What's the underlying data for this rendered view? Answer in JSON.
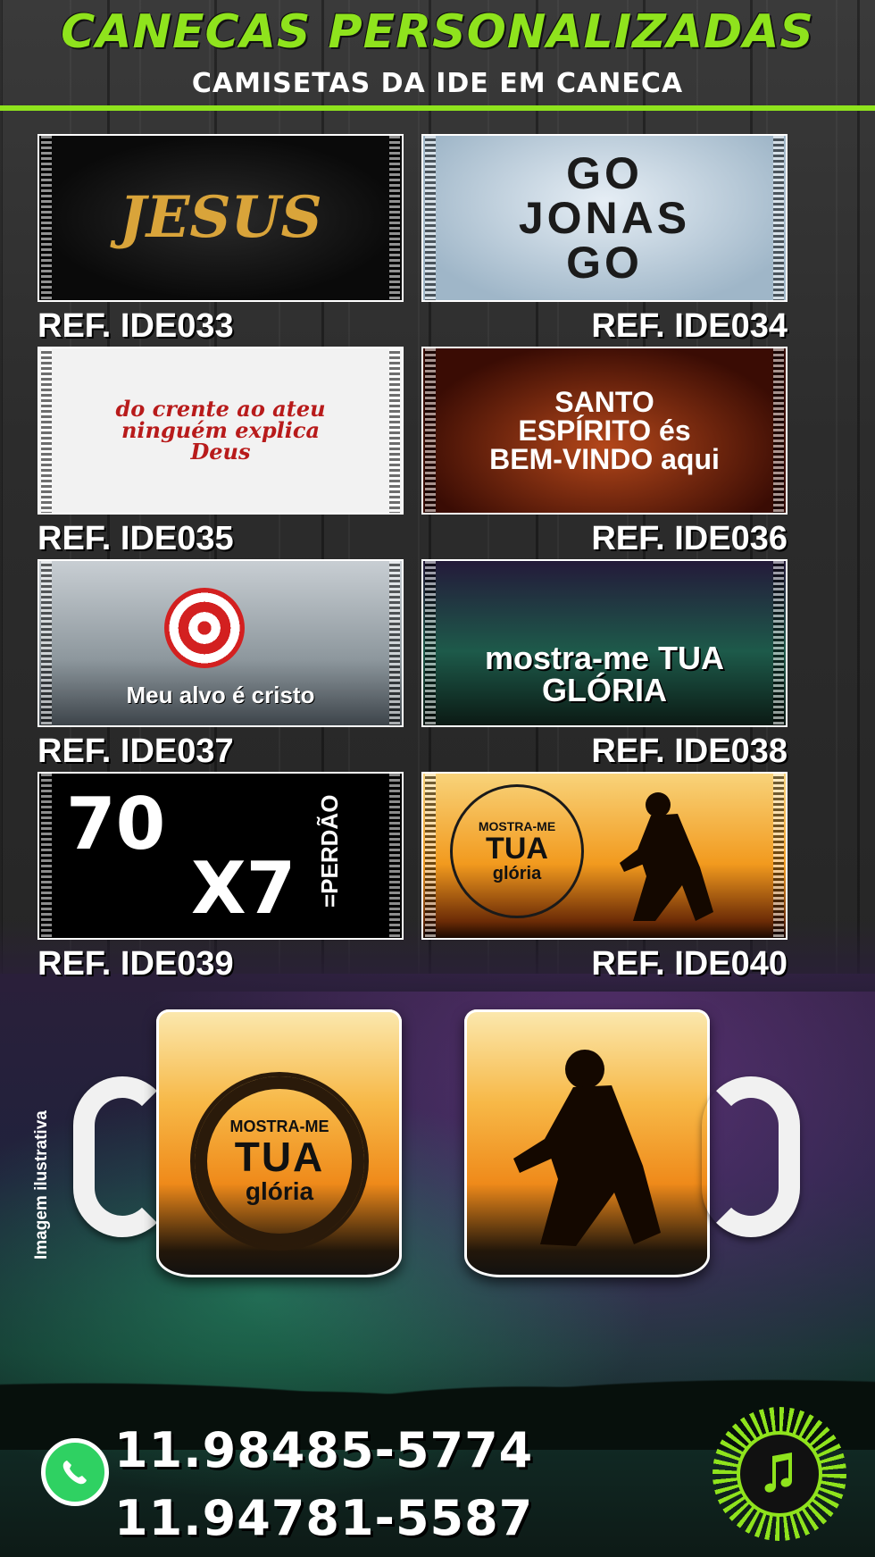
{
  "header": {
    "title": "CANECAS PERSONALIZADAS",
    "subtitle": "CAMISETAS DA IDE EM CANECA"
  },
  "products": [
    {
      "ref": "REF. IDE033",
      "art_text": "JESUS"
    },
    {
      "ref": "REF. IDE034",
      "art_text": "GO JONAS GO"
    },
    {
      "ref": "REF. IDE035",
      "art_text": "do crente ao ateu ninguém explica Deus"
    },
    {
      "ref": "REF. IDE036",
      "art_text": "SANTO ESPÍRITO és BEM-VINDO aqui"
    },
    {
      "ref": "REF. IDE037",
      "art_text": "Meu alvo é cristo"
    },
    {
      "ref": "REF. IDE038",
      "art_text": "mostra-me TUA GLÓRIA"
    },
    {
      "ref": "REF. IDE039",
      "art_text_1": "70",
      "art_text_2": "X7",
      "art_text_3": "=PERDÃO"
    },
    {
      "ref": "REF. IDE040",
      "art_text_1": "MOSTRA-ME",
      "art_text_2": "TUA",
      "art_text_3": "glória"
    }
  ],
  "mockup": {
    "side_note": "Imagem ilustrativa",
    "seal_top": "MOSTRA-ME",
    "seal_mid": "TUA",
    "seal_bottom": "glória"
  },
  "contact": {
    "phone_1": "11.98485-5774",
    "phone_2": "11.94781-5587"
  },
  "colors": {
    "accent": "#8fe31d",
    "whatsapp": "#2fd162"
  },
  "icons": [
    "whatsapp-icon",
    "brand-logo"
  ]
}
